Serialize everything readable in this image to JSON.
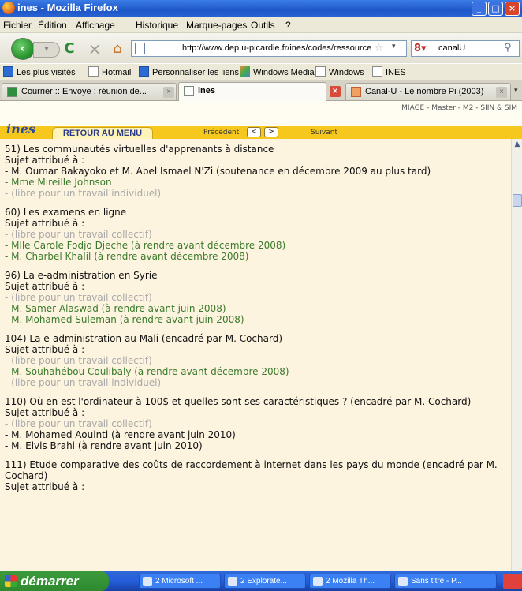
{
  "window": {
    "title": "ines - Mozilla Firefox"
  },
  "menu": [
    "Fichier",
    "Édition",
    "Affichage",
    "Historique",
    "Marque-pages",
    "Outils",
    "?"
  ],
  "navbar": {
    "url": "http://www.dep.u-picardie.fr/ines/codes/ressources/ct",
    "search_value": "canalU"
  },
  "bookmarks": [
    {
      "label": "Les plus visités",
      "icon": "bookmark-folder-icon"
    },
    {
      "label": "Hotmail",
      "icon": "page-icon"
    },
    {
      "label": "Personnaliser les liens",
      "icon": "link-icon"
    },
    {
      "label": "Windows Media",
      "icon": "media-icon"
    },
    {
      "label": "Windows",
      "icon": "page-icon"
    },
    {
      "label": "INES",
      "icon": "page-icon"
    }
  ],
  "tabs": [
    {
      "label": "Courrier :: Envoye : réunion de..."
    },
    {
      "label": "ines",
      "active": true
    },
    {
      "label": "Canal-U - Le nombre Pi (2003)"
    }
  ],
  "site": {
    "logo": "ines",
    "breadcrumb": "MIAGE - Master - M2 - SIIN & SIM",
    "back_menu": "RETOUR AU MENU",
    "prev_label": "Précédent",
    "next_label": "Suivant",
    "prev_arrow": "<",
    "next_arrow": ">"
  },
  "assigned_label": "Sujet attribué à :",
  "subjects": [
    {
      "title": "51) Les communautés virtuelles d'apprenants à distance",
      "assignees": [
        {
          "text": "- M. Oumar Bakayoko et M. Abel Ismael N'Zi (soutenance en décembre 2009 au plus tard)",
          "status": "black"
        },
        {
          "text": "- Mme Mireille Johnson",
          "status": "green"
        },
        {
          "text": "- (libre pour un travail individuel)",
          "status": "grey"
        }
      ]
    },
    {
      "title": "60) Les examens en ligne",
      "assignees": [
        {
          "text": "- (libre pour un travail collectif)",
          "status": "grey"
        },
        {
          "text": "- Mlle Carole Fodjo Djeche (à rendre avant décembre 2008)",
          "status": "green"
        },
        {
          "text": "- M. Charbel Khalil (à rendre avant décembre 2008)",
          "status": "green"
        }
      ]
    },
    {
      "title": "96) La e-administration en Syrie",
      "assignees": [
        {
          "text": "- (libre pour un travail collectif)",
          "status": "grey"
        },
        {
          "text": "- M. Samer Alaswad (à rendre avant juin 2008)",
          "status": "green"
        },
        {
          "text": "- M. Mohamed Suleman (à rendre avant juin 2008)",
          "status": "green"
        }
      ]
    },
    {
      "title": "104) La e-administration au Mali (encadré par M. Cochard)",
      "assignees": [
        {
          "text": "- (libre pour un travail collectif)",
          "status": "grey"
        },
        {
          "text": "- M. Souhahébou Coulibaly (à rendre avant décembre 2008)",
          "status": "green"
        },
        {
          "text": "- (libre pour un travail individuel)",
          "status": "grey"
        }
      ]
    },
    {
      "title": "110) Où en est l'ordinateur à 100$ et quelles sont ses caractéristiques ? (encadré par M. Cochard)",
      "assignees": [
        {
          "text": "- (libre pour un travail collectif)",
          "status": "grey"
        },
        {
          "text": "- M. Mohamed Aouinti (à rendre avant juin 2010)",
          "status": "black"
        },
        {
          "text": "- M. Elvis Brahi (à rendre avant juin 2010)",
          "status": "black"
        }
      ]
    },
    {
      "title": "111) Etude comparative des coûts de raccordement à internet dans les pays du monde (encadré par M. Cochard)",
      "assignees": []
    }
  ],
  "taskbar": {
    "start": "démarrer",
    "items": [
      "2 Microsoft ...",
      "2 Explorate...",
      "2 Mozilla Th...",
      "Sans titre - P..."
    ]
  },
  "colors": {
    "assigned_green": "#3a7a2a",
    "free_grey": "#a8a8a8",
    "page_background": "#fdf4e0",
    "header_band": "#f6c81e"
  }
}
